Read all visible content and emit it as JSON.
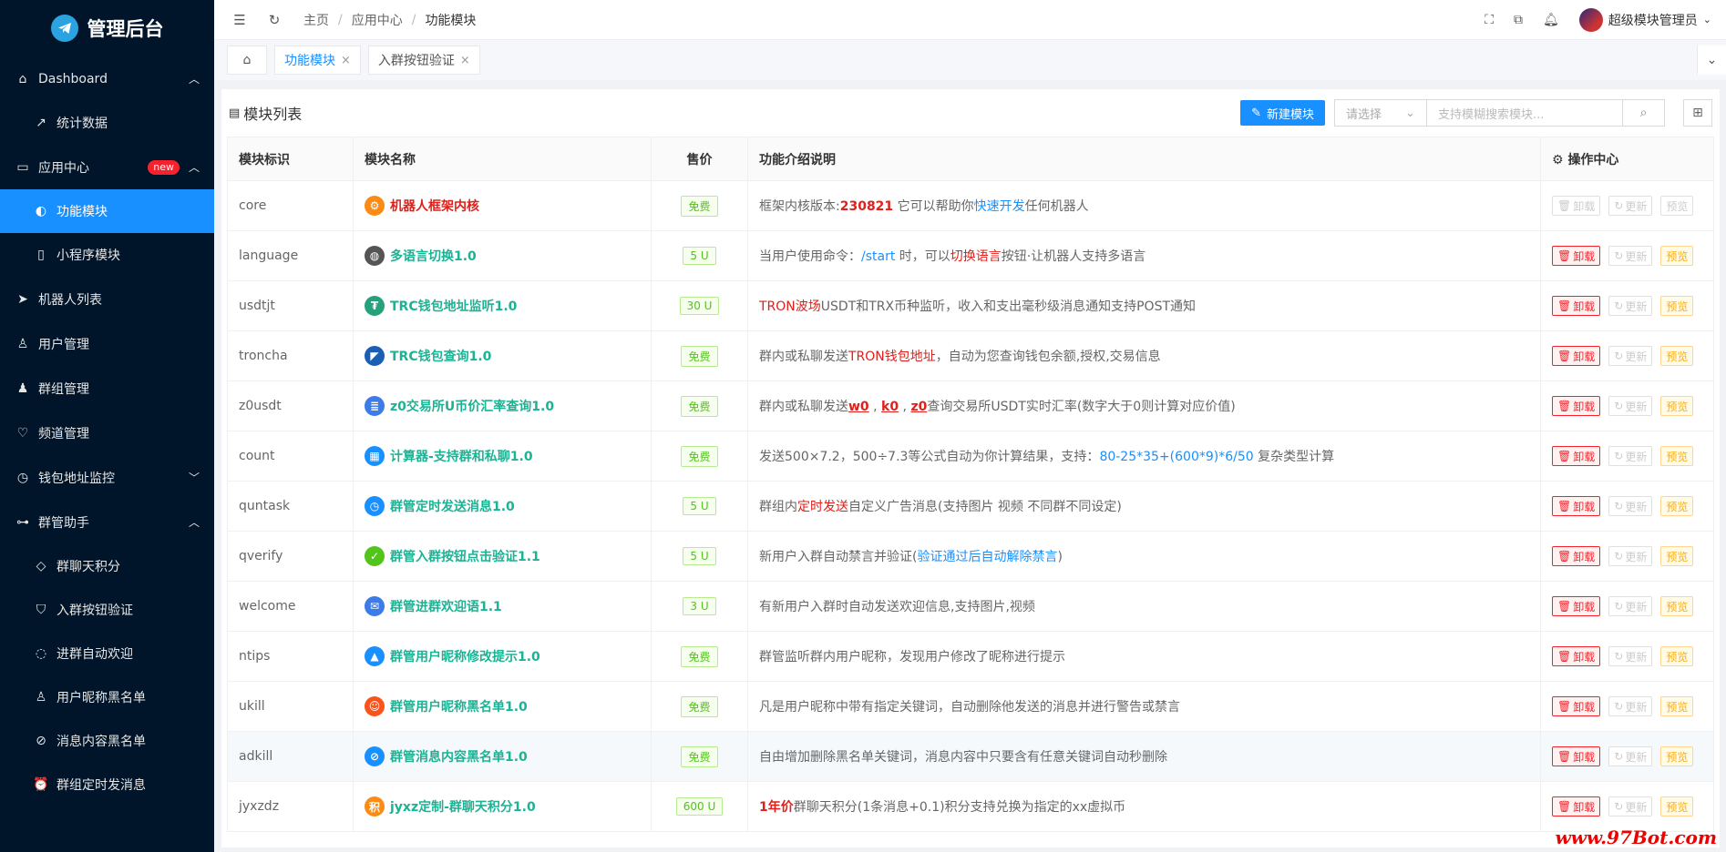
{
  "app": {
    "title": "管理后台"
  },
  "sidebar": {
    "items": [
      {
        "label": "Dashboard",
        "icon": "home-icon",
        "type": "group",
        "chevron": "⌃"
      },
      {
        "label": "统计数据",
        "icon": "trend-icon",
        "type": "sub"
      },
      {
        "label": "应用中心",
        "icon": "app-icon",
        "type": "group",
        "badge": "new",
        "chevron": "⌃"
      },
      {
        "label": "功能模块",
        "icon": "toggle-icon",
        "type": "sub",
        "active": true
      },
      {
        "label": "小程序模块",
        "icon": "phone-icon",
        "type": "sub"
      },
      {
        "label": "机器人列表",
        "icon": "send-icon",
        "type": "group"
      },
      {
        "label": "用户管理",
        "icon": "user-icon",
        "type": "group"
      },
      {
        "label": "群组管理",
        "icon": "users-icon",
        "type": "group"
      },
      {
        "label": "频道管理",
        "icon": "heart-icon",
        "type": "group"
      },
      {
        "label": "钱包地址监控",
        "icon": "clock-icon",
        "type": "group",
        "chevron": "⌄"
      },
      {
        "label": "群管助手",
        "icon": "tree-icon",
        "type": "group",
        "chevron": "⌃"
      },
      {
        "label": "群聊天积分",
        "icon": "diamond-icon",
        "type": "sub"
      },
      {
        "label": "入群按钮验证",
        "icon": "shield-icon",
        "type": "sub"
      },
      {
        "label": "进群自动欢迎",
        "icon": "chat-icon",
        "type": "sub"
      },
      {
        "label": "用户昵称黑名单",
        "icon": "user-icon",
        "type": "sub"
      },
      {
        "label": "消息内容黑名单",
        "icon": "eye-off-icon",
        "type": "sub"
      },
      {
        "label": "群组定时发消息",
        "icon": "alarm-icon",
        "type": "sub"
      }
    ]
  },
  "topbar": {
    "breadcrumb": [
      "主页",
      "应用中心",
      "功能模块"
    ],
    "user_name": "超级模块管理员"
  },
  "tabs": [
    {
      "label": "功能模块",
      "active": true
    },
    {
      "label": "入群按钮验证",
      "active": false
    }
  ],
  "card": {
    "title": "模块列表",
    "new_button": "新建模块",
    "select_placeholder": "请选择",
    "search_placeholder": "支持模糊搜索模块..."
  },
  "table": {
    "headers": [
      "模块标识",
      "模块名称",
      "售价",
      "功能介绍说明",
      "操作中心"
    ],
    "actions": {
      "uninstall": "卸载",
      "update": "更新",
      "preview": "预览"
    },
    "rows": [
      {
        "id": "core",
        "name": "机器人框架内核",
        "icon": "gear-icon",
        "icon_color": "#fa8c16",
        "red": true,
        "price": "免费",
        "desc": [
          [
            "框架内核版本:",
            ""
          ],
          [
            "230821",
            "red-b"
          ],
          [
            " 它可以帮助你",
            ""
          ],
          [
            "快速开发",
            "blue"
          ],
          [
            "任何机器人",
            ""
          ]
        ],
        "disabled": true
      },
      {
        "id": "language",
        "name": "多语言切换1.0",
        "icon": "globe-icon",
        "icon_color": "#555",
        "price": "5 U",
        "desc": [
          [
            "当用户使用命令：",
            ""
          ],
          [
            "/start",
            "blue"
          ],
          [
            " 时，可以",
            ""
          ],
          [
            "切换语言",
            "red"
          ],
          [
            "按钮·让机器人支持多语言",
            ""
          ]
        ]
      },
      {
        "id": "usdtjt",
        "name": "TRC钱包地址监听1.0",
        "icon": "tether-icon",
        "icon_color": "#26a17b",
        "price": "30 U",
        "desc": [
          [
            "TRON波场",
            "red"
          ],
          [
            "USDT和TRX币种监听，收入和支出毫秒级消息通知支持POST通知",
            ""
          ]
        ]
      },
      {
        "id": "troncha",
        "name": "TRC钱包查询1.0",
        "icon": "tron-icon",
        "icon_color": "#1a5fb4",
        "price": "免费",
        "desc": [
          [
            "群内或私聊发送",
            ""
          ],
          [
            "TRON钱包地址",
            "red"
          ],
          [
            "，自动为您查询钱包余额,授权,交易信息",
            ""
          ]
        ]
      },
      {
        "id": "z0usdt",
        "name": "z0交易所U币价汇率查询1.0",
        "icon": "list-icon",
        "icon_color": "#3d7be6",
        "price": "免费",
        "desc": [
          [
            "群内或私聊发送",
            ""
          ],
          [
            "w0",
            "red-u"
          ],
          [
            " , ",
            ""
          ],
          [
            "k0",
            "red-u"
          ],
          [
            " , ",
            ""
          ],
          [
            "z0",
            "red-u"
          ],
          [
            "查询交易所USDT实时汇率(数字大于0则计算对应价值)",
            ""
          ]
        ]
      },
      {
        "id": "count",
        "name": "计算器-支持群和私聊1.0",
        "icon": "calc-icon",
        "icon_color": "#1890ff",
        "price": "免费",
        "desc": [
          [
            "发送500×7.2，500÷7.3等公式自动为你计算结果，支持：",
            ""
          ],
          [
            "80-25*35+(600*9)*6/50",
            "blue"
          ],
          [
            " 复杂类型计算",
            ""
          ]
        ]
      },
      {
        "id": "quntask",
        "name": "群管定时发送消息1.0",
        "icon": "timer-icon",
        "icon_color": "#1890ff",
        "price": "5 U",
        "desc": [
          [
            "群组内",
            ""
          ],
          [
            "定时发送",
            "red"
          ],
          [
            "自定义广告消息(支持图片 视频 不同群不同设定)",
            ""
          ]
        ]
      },
      {
        "id": "qverify",
        "name": "群管入群按钮点击验证1.1",
        "icon": "shield-check-icon",
        "icon_color": "#52c41a",
        "price": "5 U",
        "desc": [
          [
            "新用户入群自动禁言并验证(",
            ""
          ],
          [
            "验证通过后自动解除禁言",
            "blue"
          ],
          [
            ")",
            ""
          ]
        ]
      },
      {
        "id": "welcome",
        "name": "群管进群欢迎语1.1",
        "icon": "message-icon",
        "icon_color": "#3d7be6",
        "price": "3 U",
        "desc": [
          [
            "有新用户入群时自动发送欢迎信息,支持图片,视频",
            ""
          ]
        ]
      },
      {
        "id": "ntips",
        "name": "群管用户昵称修改提示1.0",
        "icon": "bell-icon",
        "icon_color": "#1890ff",
        "price": "免费",
        "desc": [
          [
            "群管监听群内用户昵称，发现用户修改了昵称进行提示",
            ""
          ]
        ]
      },
      {
        "id": "ukill",
        "name": "群管用户昵称黑名单1.0",
        "icon": "user-ban-icon",
        "icon_color": "#fa541c",
        "price": "免费",
        "desc": [
          [
            "凡是用户昵称中带有指定关键词，自动删除他发送的消息并进行警告或禁言",
            ""
          ]
        ]
      },
      {
        "id": "adkill",
        "name": "群管消息内容黑名单1.0",
        "icon": "eye-slash-icon",
        "icon_color": "#1890ff",
        "price": "免费",
        "highlight": true,
        "desc": [
          [
            "自由增加删除黑名单关键词，消息内容中只要含有任意关键词自动秒删除",
            ""
          ]
        ]
      },
      {
        "id": "jyxzdz",
        "name": "jyxz定制-群聊天积分1.0",
        "icon": "points-icon",
        "icon_color": "#fa8c16",
        "price": "600 U",
        "desc": [
          [
            "1年价",
            "red-b"
          ],
          [
            "群聊天积分(1条消息+0.1)积分支持兑换为指定的xx虚拟币",
            ""
          ]
        ]
      }
    ]
  },
  "watermark": "www.97Bot.com"
}
